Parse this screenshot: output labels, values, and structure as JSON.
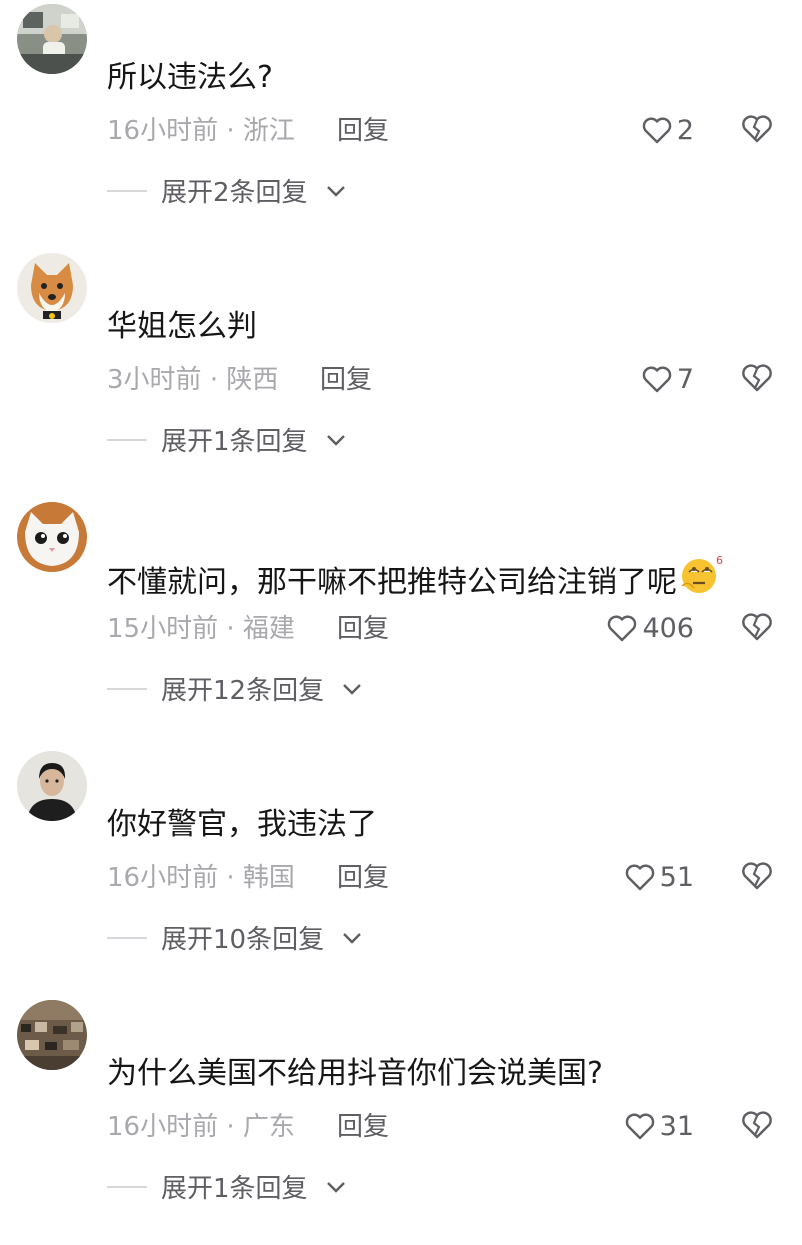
{
  "comments": [
    {
      "text": "所以违法么?",
      "time": "16小时前",
      "location": "浙江",
      "reply_label": "回复",
      "likes": "2",
      "expand_label": "展开2条回复",
      "avatar": "person-at-desk-avatar"
    },
    {
      "text": "华姐怎么判",
      "time": "3小时前",
      "location": "陕西",
      "reply_label": "回复",
      "likes": "7",
      "expand_label": "展开1条回复",
      "avatar": "shiba-dog-avatar"
    },
    {
      "text": "不懂就问，那干嘛不把推特公司给注销了呢",
      "time": "15小时前",
      "location": "福建",
      "reply_label": "回复",
      "likes": "406",
      "expand_label": "展开12条回复",
      "avatar": "white-cat-avatar",
      "emoji": "eye-roll-emoji"
    },
    {
      "text": "你好警官，我违法了",
      "time": "16小时前",
      "location": "韩国",
      "reply_label": "回复",
      "likes": "51",
      "expand_label": "展开10条回复",
      "avatar": "man-portrait-avatar"
    },
    {
      "text": "为什么美国不给用抖音你们会说美国?",
      "time": "16小时前",
      "location": "广东",
      "reply_label": "回复",
      "likes": "31",
      "expand_label": "展开1条回复",
      "avatar": "crowd-photo-avatar"
    }
  ],
  "colors": {
    "text": "#161616",
    "meta": "#a9a9ad",
    "action": "#5e5e63",
    "divider": "#d8d8dc"
  },
  "separator": "·"
}
